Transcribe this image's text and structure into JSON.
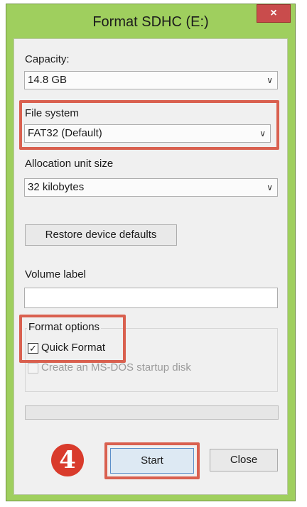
{
  "window": {
    "title": "Format SDHC (E:)",
    "close_glyph": "×"
  },
  "capacity": {
    "label": "Capacity:",
    "value": "14.8 GB"
  },
  "file_system": {
    "label": "File system",
    "value": "FAT32 (Default)"
  },
  "allocation": {
    "label": "Allocation unit size",
    "value": "32 kilobytes"
  },
  "restore_button": "Restore device defaults",
  "volume": {
    "label": "Volume label",
    "value": ""
  },
  "format_options": {
    "label": "Format options",
    "quick_format": {
      "label": "Quick Format",
      "checked": true
    },
    "msdos": {
      "label": "Create an MS-DOS startup disk",
      "checked": false
    }
  },
  "progress_value": 0,
  "buttons": {
    "start": "Start",
    "close": "Close"
  },
  "step_badge": "4",
  "colors": {
    "frame": "#9fcf5e",
    "highlight": "#d9604f",
    "badge": "#d93b2c",
    "close": "#c94c4c"
  },
  "icons": {
    "close": "close-icon",
    "dropdown": "chevron-down-icon",
    "check": "check-icon"
  }
}
